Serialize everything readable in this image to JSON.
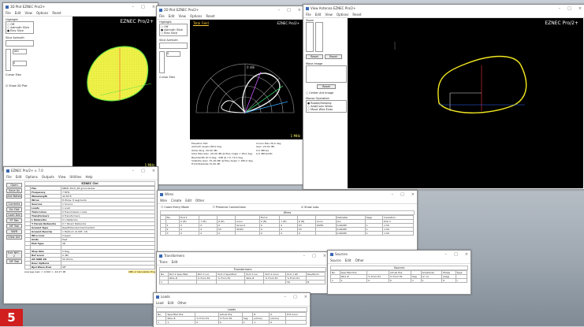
{
  "badge": "5",
  "windows": {
    "w1": {
      "title": "3D Plot  EZNEC Pro/2+",
      "menu": [
        "File",
        "Edit",
        "View",
        "Options",
        "Reset"
      ],
      "brand": "EZNEC Pro/2+",
      "footer": "1 MHz",
      "panel": {
        "section": "Highlight",
        "opts": [
          "Off",
          "Azimuth Slice",
          "Elev Slice"
        ],
        "elev_label": "Elevation",
        "elev_val": "180",
        "az_label": "Slice Azimuth",
        "az_val": "0",
        "curve": "Cursor Elev",
        "show": "Show 2D Plot"
      }
    },
    "w2": {
      "title": "2D Plot  EZNEC Pro/2+",
      "menu": [
        "File",
        "Edit",
        "View",
        "Options",
        "Reset"
      ],
      "tab": "Total Field",
      "brand": "EZNEC Pro/2+",
      "footer": "1 MHz",
      "panel": {
        "section": "Highlight",
        "opts": [
          "Off",
          "Azimuth Slice",
          "Elev Slice"
        ],
        "az_label": "Slice Azimuth",
        "az_val": "0",
        "curve": "Cursor Elev"
      },
      "ring_label": "0 dBi",
      "stats": [
        "Elevation Plot",
        "Azimuth Angle   180.0 deg",
        "Outer Ring        -20.00 dBi",
        "Slice Max Gain  -20.00 dBi @ Elev Angle = 26.0 deg",
        "Beamwidth   67.0 deg; -3dB @ 7.0, 74.0 deg",
        "Sidelobe Gain  -51.00 dBi @ Elev Angle = 180.0 deg",
        "Front/Sidelobe   31.00 dB"
      ],
      "stats_r": [
        "Cursor Elev   26.0 deg",
        "Gain    -20.01 dBi",
        "    0.0 dBmax",
        "    0.0 dBmax3D"
      ]
    },
    "w3": {
      "title": "View Antenna  EZNEC Pro/2+",
      "menu": [
        "File",
        "Edit",
        "View",
        "Options",
        "Reset"
      ],
      "brand": "EZNEC Pro/2+",
      "zoom": "Zoom",
      "reset": "Reset",
      "move": "Move Image",
      "center": "Center Ant Image",
      "mouse": "Mouse Operation",
      "m_opts": [
        "Rotate/Viewing",
        "Add/Conn Wires",
        "Move Wire Ends"
      ]
    },
    "main": {
      "title": "EZNEC Pro/2+ v. 7.0",
      "menu": [
        "File",
        "Edit",
        "Options",
        "Outputs",
        "View",
        "Utilities",
        "Help"
      ],
      "buttons": [
        "Open",
        "Save As",
        "Ant Notes",
        "Currents",
        "Src Dat",
        "Load Dat",
        "FF Tab",
        "NF Tab",
        "SWR",
        "View Ant"
      ],
      "buttons2": [
        "Exit NEC-2",
        "NF Tab"
      ],
      "header": "EZNEC Ctrl",
      "rows": [
        [
          "File",
          "DBMs 35x5_28 groundedue"
        ],
        [
          "Frequency",
          "7 MHz"
        ],
        [
          "Wavelength",
          "42.83 ft"
        ],
        [
          "Wires",
          "8 Wires, 8 segments"
        ],
        [
          "Sources",
          "1 Source"
        ],
        [
          "Loads",
          "1 Load"
        ],
        [
          "Trans Lines",
          "0 Transmission Lines"
        ],
        [
          "Transformers",
          "0 Transformers"
        ],
        [
          "L Networks",
          "0 L Networks"
        ],
        [
          "Y Param Networks",
          "0 Y Param Networks"
        ],
        [
          "Ground Type",
          "Real/Extended Sommerfeld"
        ],
        [
          "Ground Descrip",
          "1 Medium (0.005, 13)"
        ],
        [
          "Wire Loss",
          "Copper"
        ],
        [
          "Units",
          "Feet"
        ],
        [
          "Plot Type",
          "3D"
        ],
        [
          "",
          ""
        ],
        [
          "Step Size",
          "5 Deg"
        ],
        [
          "Ref Level",
          "0 dBi"
        ],
        [
          "Alt SWR Z0",
          "50 Ohms"
        ],
        [
          "Desc Options",
          ""
        ],
        [
          "Rpd Wave Eval",
          "Off"
        ]
      ],
      "status": "Average Gain = 0.000 = -44.27 dB",
      "status2": "NEC-2 Calculation Eng"
    },
    "wires": {
      "title": "Wires",
      "menu": [
        "Wire",
        "Create",
        "Edit",
        "Other"
      ],
      "chk": [
        "Coord Entry Mode",
        "Preserve Connections",
        "Show Loss"
      ],
      "group": "Wires",
      "h1": [
        "",
        "No.",
        "End 1",
        "",
        "",
        "",
        "End 2",
        "",
        "",
        "",
        "Diameter",
        "Segs",
        "Insulation"
      ],
      "h2": [
        "",
        "",
        "X (ft)",
        "Y (ft)",
        "Z (ft)",
        "Conn",
        "X (ft)",
        "Y (ft)",
        "Z (ft)",
        "Conn",
        "(in)",
        "",
        "Diel C"
      ],
      "rows": [
        [
          "",
          "1",
          "0",
          "0",
          "0",
          "Ground",
          "0",
          "0",
          "53",
          "W2E1",
          "0.06285",
          "1",
          "1.50"
        ],
        [
          "",
          "2",
          "0",
          "0",
          "53",
          "W1E2",
          "0",
          "0",
          "53",
          "",
          "0.06285",
          "1",
          "1.50"
        ],
        [
          "",
          "3",
          "0",
          "0",
          "0",
          "",
          "0",
          "0",
          "0",
          "",
          "0.06285",
          "1",
          "1.50"
        ]
      ]
    },
    "transformers": {
      "title": "Transformers",
      "menu": [
        "Trans",
        "Edit"
      ],
      "group": "Transformers",
      "h": [
        "No.",
        "Port 1 Specified",
        "Port 1 Loc",
        "Port 2 Specified",
        "Port 2 Loc",
        "Port 2 Conn",
        "Port 1 Z0",
        "Rev/Norm"
      ],
      "h2": [
        "",
        "Wire #",
        "% From E1",
        "% From E1",
        "Wire #",
        "% From E1",
        "% From E1",
        ""
      ],
      "rows": [
        [
          "1",
          "",
          "",
          "",
          "",
          "",
          "50",
          "N"
        ]
      ]
    },
    "sources": {
      "title": "Sources",
      "menu": [
        "Source",
        "Edit",
        "Other"
      ],
      "group": "Sources",
      "h": [
        "No.",
        "Specified Pos.",
        "",
        "Actual Pos.",
        "",
        "Amplitude",
        "Phase",
        "Type"
      ],
      "h2": [
        "",
        "Wire #",
        "% From E1",
        "% From E1",
        "Seg",
        "(V, A)",
        "(deg)",
        ""
      ],
      "rows": [
        [
          "1",
          "1",
          "0",
          "0",
          "1",
          "1",
          "0",
          "I"
        ]
      ]
    },
    "loads": {
      "title": "Loads",
      "menu": [
        "Load",
        "Edit",
        "Other"
      ],
      "group": "Loads",
      "h": [
        "No.",
        "Specified Pos.",
        "",
        "Actual Pos.",
        "",
        "R",
        "X",
        "Ext Conn"
      ],
      "h2": [
        "",
        "Wire #",
        "% From E1",
        "% From E1",
        "Seg",
        "(ohms)",
        "(ohms)",
        ""
      ],
      "rows": [
        [
          "1",
          "1",
          "0",
          "0",
          "1",
          "1",
          "0",
          ""
        ]
      ]
    }
  },
  "chart_colors": {
    "mesh": "#ffff33",
    "mesh_edge": "#44ee33",
    "outline": "#f0e61e",
    "polar_grid": "#9a9a9a",
    "pattern": "#222222"
  }
}
